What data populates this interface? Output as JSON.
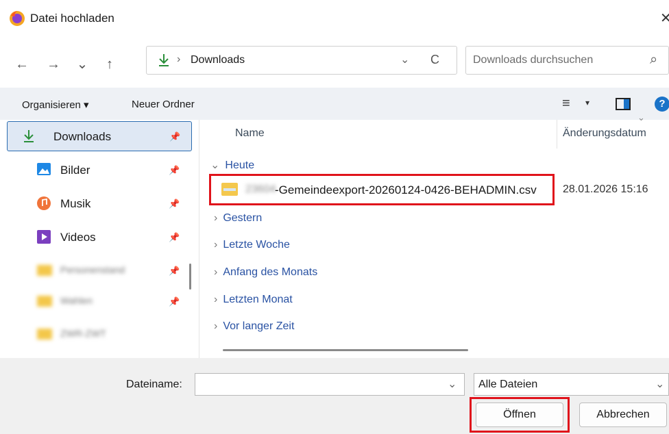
{
  "window": {
    "title": "Datei hochladen",
    "close_glyph": "✕"
  },
  "nav": {
    "back": "←",
    "forward": "→",
    "recent": "⌄",
    "up": "↑"
  },
  "address": {
    "icon": "download-arrow-icon",
    "separator": "›",
    "location": "Downloads",
    "dropdown": "⌄",
    "refresh": "C"
  },
  "search": {
    "placeholder": "Downloads durchsuchen",
    "icon": "⌕"
  },
  "commandbar": {
    "organize": "Organisieren ▾",
    "new_folder": "Neuer Ordner",
    "view_glyph": "≡",
    "view_caret": "▾",
    "help": "?"
  },
  "sidebar": {
    "items": [
      {
        "label": "Downloads",
        "selected": true,
        "icon": "download-icon"
      },
      {
        "label": "Bilder",
        "icon": "pictures-icon"
      },
      {
        "label": "Musik",
        "icon": "music-icon"
      },
      {
        "label": "Videos",
        "icon": "videos-icon"
      },
      {
        "label": "Personenstand",
        "blurred": true,
        "icon": "folder-icon"
      },
      {
        "label": "Wahlen",
        "blurred": true,
        "icon": "folder-icon"
      },
      {
        "label": "ZWR-ZWT",
        "blurred": true,
        "icon": "folder-icon"
      }
    ],
    "pin": "📌"
  },
  "columns": {
    "name": "Name",
    "date": "Änderungsdatum"
  },
  "groups": {
    "today": "Heute",
    "yesterday": "Gestern",
    "last_week": "Letzte Woche",
    "month_start": "Anfang des Monats",
    "last_month": "Letzten Monat",
    "long_ago": "Vor langer Zeit"
  },
  "file": {
    "prefix_blurred": "23604",
    "name": "-Gemeindeexport-20260124-0426-BEHADMIN.csv",
    "date": "28.01.2026 15:16"
  },
  "footer": {
    "filename_label": "Dateiname:",
    "filename_value": "",
    "filter": "Alle Dateien",
    "open": "Öffnen",
    "cancel": "Abbrechen"
  },
  "colors": {
    "accent": "#2b6cb0",
    "highlight": "#e0131b",
    "link": "#2952a3"
  }
}
